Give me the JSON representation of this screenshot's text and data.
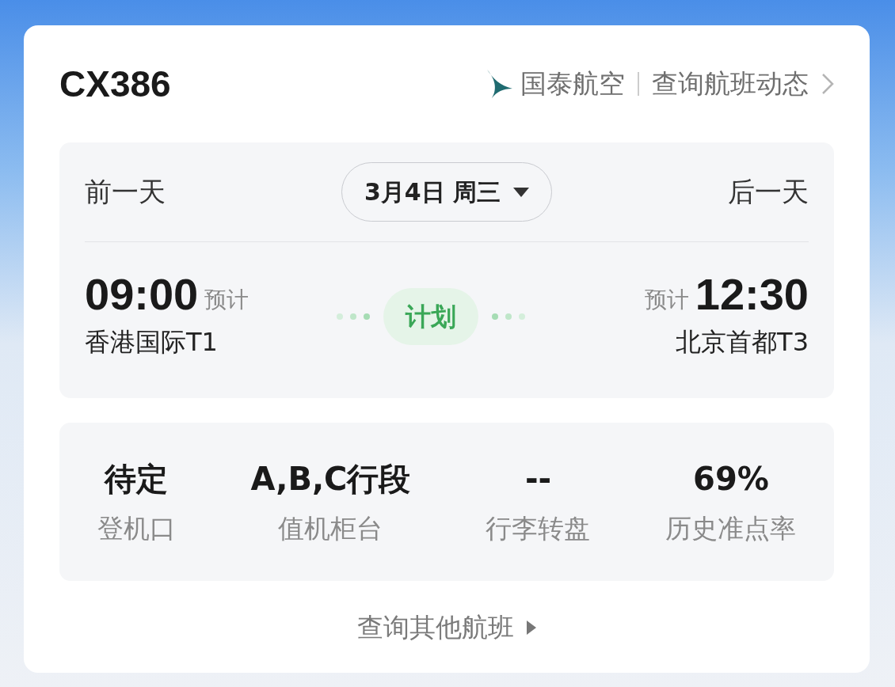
{
  "header": {
    "flight_number": "CX386",
    "airline": "国泰航空",
    "status_link": "查询航班动态"
  },
  "date_nav": {
    "previous": "前一天",
    "date": "3月4日 周三",
    "next": "后一天"
  },
  "departure": {
    "time": "09:00",
    "time_label": "预计",
    "airport": "香港国际T1"
  },
  "status": "计划",
  "arrival": {
    "time": "12:30",
    "time_label": "预计",
    "airport": "北京首都T3"
  },
  "info": [
    {
      "value": "待定",
      "label": "登机口"
    },
    {
      "value": "A,B,C行段",
      "label": "值机柜台"
    },
    {
      "value": "--",
      "label": "行李转盘"
    },
    {
      "value": "69%",
      "label": "历史准点率"
    }
  ],
  "footer_link": "查询其他航班"
}
